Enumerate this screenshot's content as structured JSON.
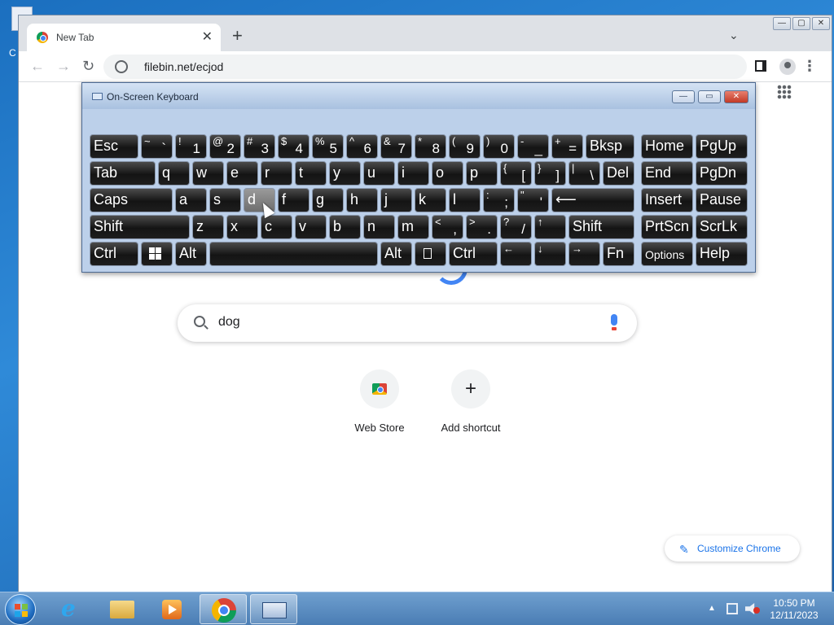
{
  "desktop": {
    "icon_label_partial": "C"
  },
  "chrome": {
    "tab": {
      "title": "New Tab",
      "close": "✕"
    },
    "new_tab": "+",
    "tab_search": "⌄",
    "window_controls": {
      "minimize": "—",
      "maximize": "▢",
      "close": "✕"
    },
    "nav": {
      "back": "←",
      "forward": "→",
      "reload": "↻"
    },
    "url": "filebin.net/ecjod",
    "menu": "⋮",
    "labs": "⚗",
    "search": {
      "value": "dog"
    },
    "shortcuts": [
      {
        "label": "Web Store",
        "icon": "web-store-icon"
      },
      {
        "label": "Add shortcut",
        "icon": "plus-icon",
        "glyph": "+"
      }
    ],
    "customize": {
      "label": "Customize Chrome",
      "icon": "✎"
    }
  },
  "osk": {
    "title": "On-Screen Keyboard",
    "controls": {
      "minimize": "—",
      "restore": "▭",
      "close": "✕"
    },
    "keys": {
      "esc": "Esc",
      "tilde": [
        "~",
        "`"
      ],
      "k1": [
        "!",
        "1"
      ],
      "k2": [
        "@",
        "2"
      ],
      "k3": [
        "#",
        "3"
      ],
      "k4": [
        "$",
        "4"
      ],
      "k5": [
        "%",
        "5"
      ],
      "k6": [
        "^",
        "6"
      ],
      "k7": [
        "&",
        "7"
      ],
      "k8": [
        "*",
        "8"
      ],
      "k9": [
        "(",
        "9"
      ],
      "k0": [
        ")",
        "0"
      ],
      "minus": [
        "-",
        "_"
      ],
      "equals": [
        "+",
        "="
      ],
      "bksp": "Bksp",
      "home": "Home",
      "pgup": "PgUp",
      "tab": "Tab",
      "q": "q",
      "w": "w",
      "e": "e",
      "r": "r",
      "t": "t",
      "y": "y",
      "u": "u",
      "i": "i",
      "o": "o",
      "p": "p",
      "lbracket": [
        "{",
        "["
      ],
      "rbracket": [
        "}",
        "]"
      ],
      "backslash": [
        "|",
        "\\"
      ],
      "del": "Del",
      "end": "End",
      "pgdn": "PgDn",
      "caps": "Caps",
      "a": "a",
      "s": "s",
      "d": "d",
      "f": "f",
      "g": "g",
      "h": "h",
      "j": "j",
      "k": "k",
      "l": "l",
      "semicolon": [
        ":",
        ";"
      ],
      "quote": [
        "\"",
        "'"
      ],
      "enter": "⟵",
      "insert": "Insert",
      "pause": "Pause",
      "lshift": "Shift",
      "z": "z",
      "x": "x",
      "c": "c",
      "v": "v",
      "b": "b",
      "n": "n",
      "m": "m",
      "comma": [
        "<",
        ","
      ],
      "period": [
        ">",
        "."
      ],
      "slash": [
        "?",
        "/"
      ],
      "up": "↑",
      "rshift": "Shift",
      "prtscn": "PrtScn",
      "scrlk": "ScrLk",
      "lctrl": "Ctrl",
      "lalt": "Alt",
      "ralt": "Alt",
      "rctrl": "Ctrl",
      "left": "←",
      "down": "↓",
      "right": "→",
      "fn": "Fn",
      "options": "Options",
      "help": "Help"
    },
    "pressed_key": "d"
  },
  "taskbar": {
    "clock": {
      "time": "10:50 PM",
      "date": "12/11/2023"
    },
    "tray_arrow": "▲",
    "ie_glyph": "e",
    "active_item": "On-Screen Keyboard"
  }
}
